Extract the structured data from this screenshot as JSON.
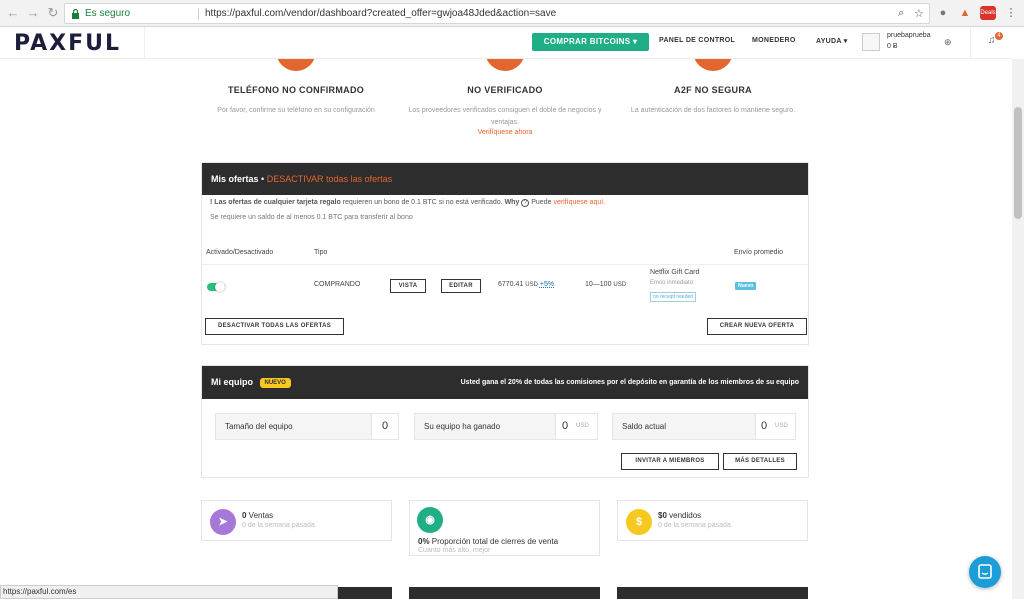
{
  "browser": {
    "secure_label": "Es seguro",
    "url": "https://paxful.com/vendor/dashboard?created_offer=gwjoa48Jded&action=save",
    "status_url": "https://paxful.com/es",
    "ext_badge": "Deals"
  },
  "header": {
    "logo": "PAXFUL",
    "buy_button": "COMPRAR BITCOINS ▾",
    "nav": [
      "PANEL DE CONTROL",
      "MONEDERO",
      "AYUDA ▾"
    ],
    "username": "pruebaprueba",
    "balance": "0 Ƀ",
    "notifications": "4"
  },
  "status": [
    {
      "title": "TELÉFONO NO CONFIRMADO",
      "desc": "Por favor, confirme su teléfono en su configuración"
    },
    {
      "title": "NO VERIFICADO",
      "desc": "Los proveedores verificados consiguen el doble de negocios y ventajas.",
      "link": "Verifíquese ahora"
    },
    {
      "title": "A2F NO SEGURA",
      "desc": "La autenticación de dos factores lo mantiene seguro."
    }
  ],
  "offers": {
    "title": "Mis ofertas",
    "bullet": "•",
    "deactivate_link": "DESACTIVAR todas las ofertas",
    "notice_bang": "!",
    "notice_bold": "Las ofertas de cualquier tarjeta regalo",
    "notice_rest": " requieren un bono de 0.1 BTC si no está verificado.",
    "notice_why": "Why",
    "notice_q": "?",
    "notice_puede": " Puede ",
    "notice_link": "verifíquese aquí.",
    "notice_line2": "Se requiere un saldo de al menos 0.1 BTC para transferir al bono",
    "columns": [
      "Activado/Desactivado",
      "Tipo",
      "Envío promedio"
    ],
    "row": {
      "type": "COMPRANDO",
      "view_button": "VISTA",
      "edit_button": "EDITAR",
      "price": "6770.41",
      "price_unit": "USD",
      "margin": "+5%",
      "range": "10—100",
      "range_unit": "USD",
      "method": "Netflix Gift Card",
      "method_sub": "Envío inmediato",
      "method_tag": "no receipt needed",
      "badge": "Nuevo",
      "active": true
    },
    "deactivate_all_button": "DESACTIVAR TODAS LAS OFERTAS",
    "create_button": "CREAR NUEVA OFERTA"
  },
  "team": {
    "title": "Mi equipo",
    "badge": "NUEVO",
    "earnings_note": "Usted gana el 20% de todas las comisiones por el depósito en garantía de los miembros de su equipo",
    "boxes": [
      {
        "label": "Tamaño del equipo",
        "value": "0",
        "unit": ""
      },
      {
        "label": "Su equipo ha ganado",
        "value": "0",
        "unit": "USD"
      },
      {
        "label": "Saldo actual",
        "value": "0",
        "unit": "USD"
      }
    ],
    "invite_button": "INVITAR A MIEMBROS",
    "details_button": "MÁS DETALLES"
  },
  "stats": [
    {
      "bold": "0",
      "rest": " Ventas",
      "sub": "0 de la semana pasada",
      "icon": "➤",
      "color": "#a678d8"
    },
    {
      "bold": "0%",
      "rest": " Proporción total de cierres de venta",
      "sub": "Cuanto más alto, mejor",
      "icon": "◉",
      "color": "#1fae85"
    },
    {
      "bold": "$0",
      "rest": " vendidos",
      "sub": "0 de la semana pasada",
      "icon": "$",
      "color": "#f7c81f"
    }
  ]
}
